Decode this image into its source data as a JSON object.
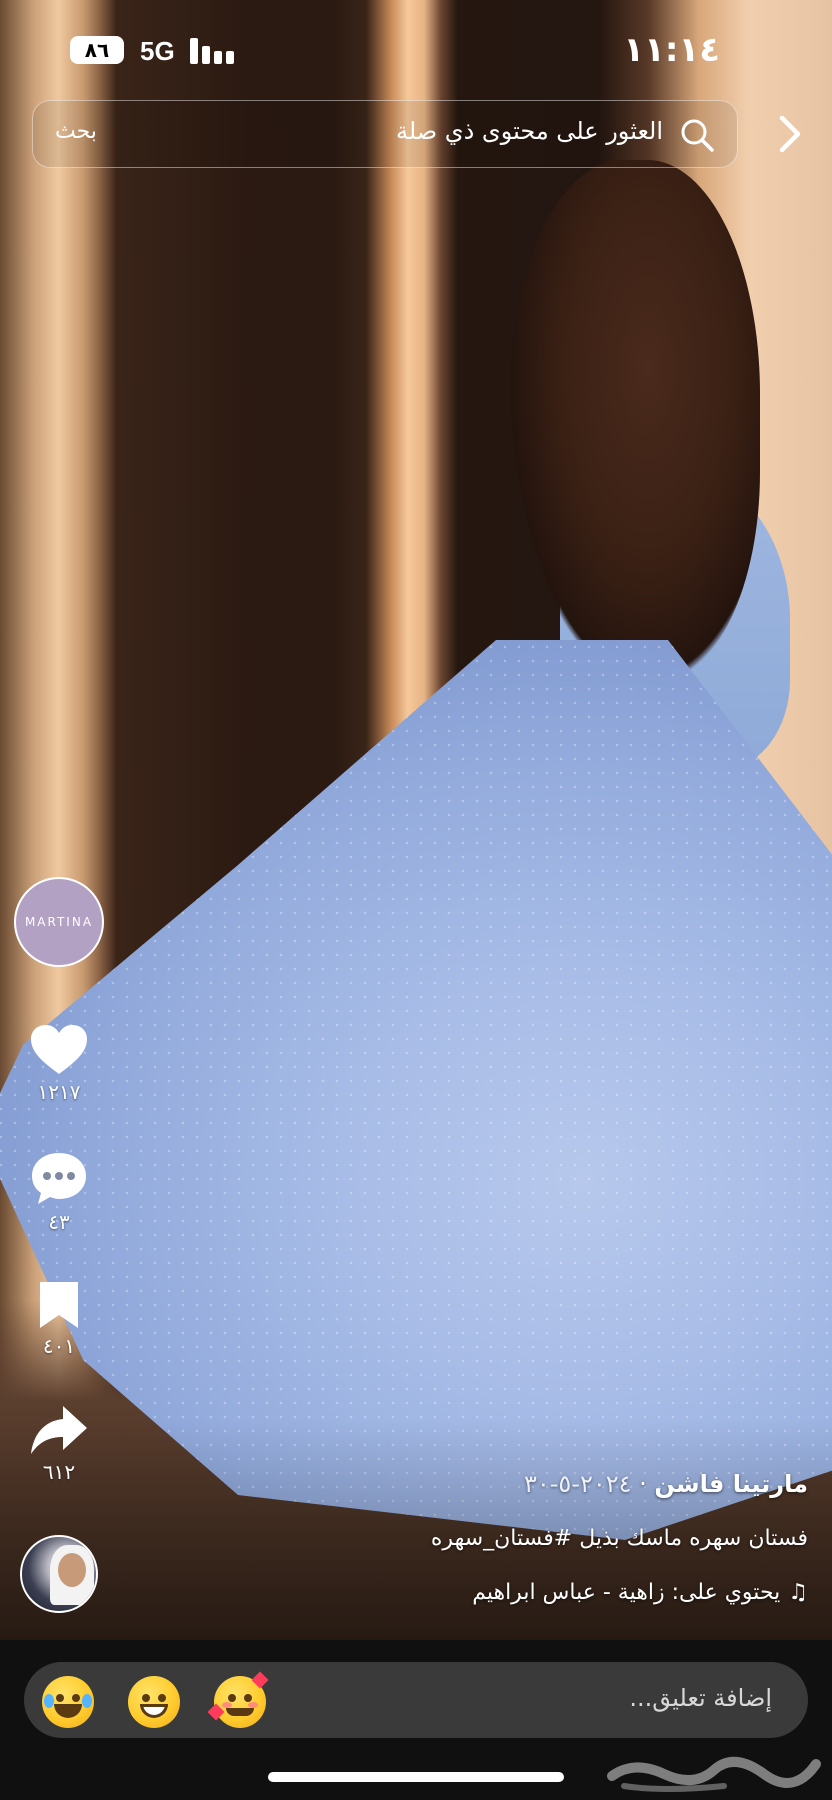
{
  "status_bar": {
    "battery": "٨٦",
    "network": "5G",
    "time": "١١:١٤"
  },
  "search": {
    "placeholder": "العثور على محتوى ذي صلة",
    "action_label": "بحث"
  },
  "account": {
    "avatar_text": "MARTINA"
  },
  "actions": {
    "likes": "١٢١٧",
    "comments": "٤٣",
    "saves": "٤٠١",
    "shares": "٦١٢"
  },
  "post": {
    "author": "مارتينا فاشن",
    "date": "٢٠٢٤-٥-٣٠",
    "separator": " · ",
    "description": "فستان سهره ماسك بذيل #فستان_سهره",
    "music": "يحتوي على: زاهية - عباس ابراهيم"
  },
  "comment_bar": {
    "placeholder": "إضافة تعليق..."
  },
  "icons": {
    "back": "chevron-right-icon",
    "search": "search-icon",
    "like": "heart-icon",
    "comment": "chat-bubble-icon",
    "save": "bookmark-icon",
    "share": "share-arrow-icon",
    "music": "music-note-icon"
  },
  "colors": {
    "comment_bar": "#3a3a3a",
    "bottom_panel": "#101010",
    "account_avatar": "#b3a1c4"
  }
}
